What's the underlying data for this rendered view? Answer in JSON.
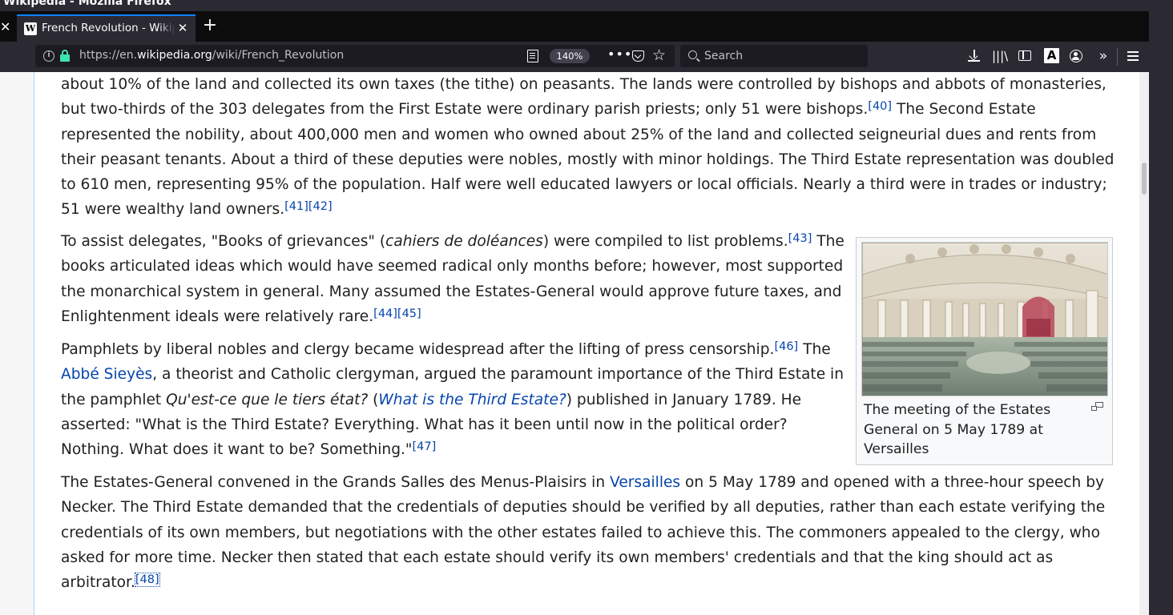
{
  "window": {
    "title": "Wikipedia - Mozilla Firefox"
  },
  "tab": {
    "title": "French Revolution - Wikipedia",
    "favicon": "W"
  },
  "url": {
    "prefix": "https://en.",
    "domain": "wikipedia.org",
    "path": "/wiki/French_Revolution"
  },
  "zoom": "140%",
  "search": {
    "placeholder": "Search"
  },
  "toolbar": {
    "font_icon": "A",
    "overflow": "»"
  },
  "article": {
    "p1": {
      "t1": "about 10% of the land and collected its own taxes (the tithe) on peasants. The lands were controlled by bishops and abbots of monasteries, but two-thirds of the 303 delegates from the First Estate were ordinary parish priests; only 51 were bishops.",
      "c40": "[40]",
      "t2": " The Second Estate represented the nobility, about 400,000 men and women who owned about 25% of the land and collected seigneurial dues and rents from their peasant tenants. About a third of these deputies were nobles, mostly with minor holdings. The Third Estate representation was doubled to 610 men, representing 95% of the population. Half were well educated lawyers or local officials. Nearly a third were in trades or industry; 51 were wealthy land owners.",
      "c41": "[41]",
      "c42": "[42]"
    },
    "p2": {
      "t1": "To assist delegates, \"Books of grievances\" (",
      "italic": "cahiers de doléances",
      "t2": ") were compiled to list problems.",
      "c43": "[43]",
      "t3": " The books articulated ideas which would have seemed radical only months before; however, most supported the monarchical system in general. Many assumed the Estates-General would approve future taxes, and Enlightenment ideals were relatively rare.",
      "c44": "[44]",
      "c45": "[45]"
    },
    "p3": {
      "t1": "Pamphlets by liberal nobles and clergy became widespread after the lifting of press censorship.",
      "c46": "[46]",
      "t2": " The ",
      "link1": "Abbé Sieyès",
      "t3": ", a theorist and Catholic clergyman, argued the paramount importance of the Third Estate in the pamphlet ",
      "italic": "Qu'est-ce que le tiers état?",
      "t4": " (",
      "link2": "What is the Third Estate?",
      "t5": ") published in January 1789. He asserted: \"What is the Third Estate? Everything. What has it been until now in the political order? Nothing. What does it want to be? Something.\"",
      "c47": "[47]"
    },
    "p4": {
      "t1": "The Estates-General convened in the Grands Salles des Menus-Plaisirs in ",
      "link1": "Versailles",
      "t2": " on 5 May 1789 and opened with a three-hour speech by Necker. The Third Estate demanded that the credentials of deputies should be verified by all deputies, rather than each estate verifying the credentials of its own members, but negotiations with the other estates failed to achieve this. The commoners appealed to the clergy, who asked for more time. Necker then stated that each estate should verify its own members' credentials and that the king should act as arbitrator.",
      "c48": "[48]"
    },
    "figure": {
      "caption": "The meeting of the Estates General on 5 May 1789 at Versailles"
    }
  }
}
